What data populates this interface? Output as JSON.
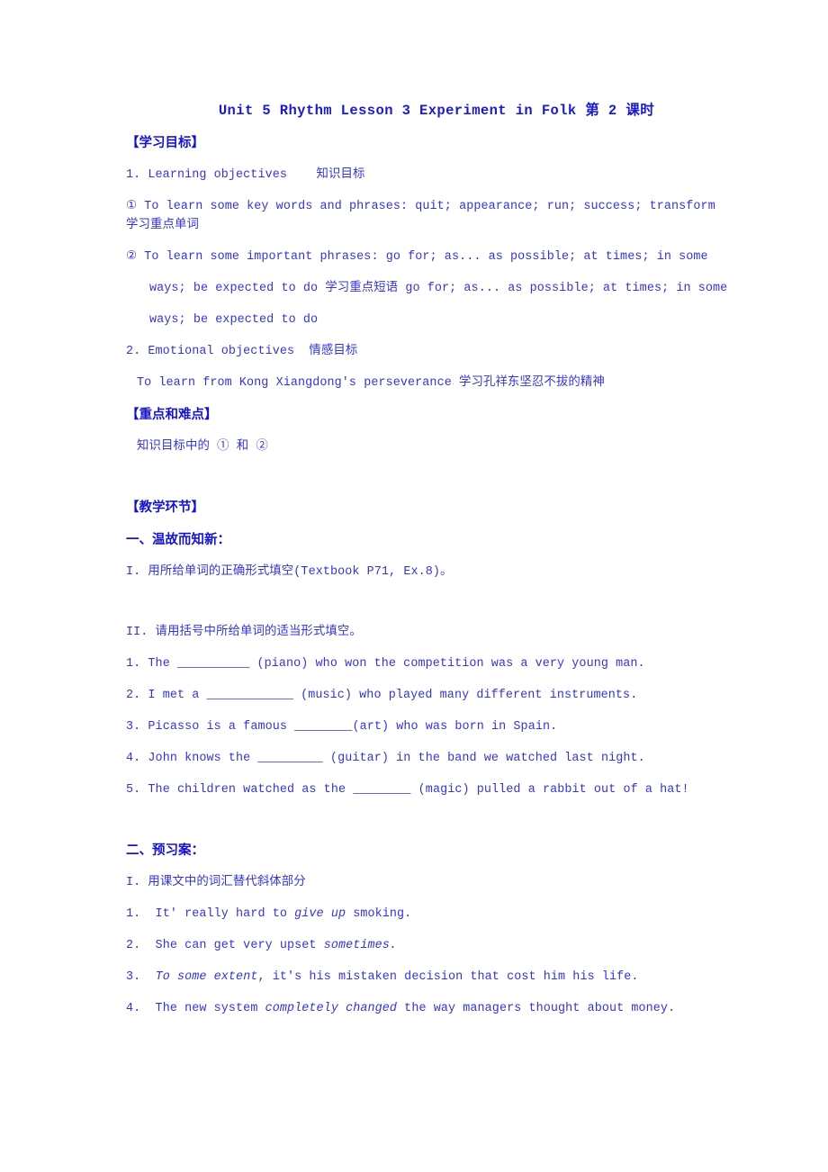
{
  "document": {
    "title": "Unit 5  Rhythm  Lesson 3 Experiment in Folk 第 2 课时",
    "sections": {
      "learning_goals_heading": "【学习目标】",
      "goal1": "1. Learning objectives    知识目标",
      "goal1_item1": "① To learn some key words and phrases: quit; appearance; run; success; transform",
      "goal1_item1_cn": "学习重点单词",
      "goal1_item2": "② To learn some important phrases: go for; as... as possible; at times; in some",
      "goal1_item2_cont": "ways; be expected to do 学习重点短语 go for; as... as possible; at times; in some",
      "goal1_item2_cont2": "ways; be expected to do",
      "goal2": "2. Emotional objectives  情感目标",
      "goal2_text": "To learn from Kong Xiangdong's perseverance 学习孔祥东坚忍不拔的精神",
      "key_points_heading": "【重点和难点】",
      "key_points_text": "知识目标中的 ① 和 ②",
      "teaching_steps_heading": "【教学环节】",
      "part_one_heading": "一、温故而知新：",
      "part_one_ex1": "I. 用所给单词的正确形式填空(Textbook P71, Ex.8)。",
      "part_one_ex2": "II. 请用括号中所给单词的适当形式填空。",
      "part_one_questions": [
        {
          "num": "1.",
          "pre": "The ",
          "blank": "__________",
          "post": " (piano) who won the competition was a very young man."
        },
        {
          "num": "2.",
          "pre": "I met a ",
          "blank": "____________",
          "post": " (music) who played many different instruments."
        },
        {
          "num": "3.",
          "pre": "Picasso is a famous ",
          "blank": "________",
          "post": "(art) who was born in Spain."
        },
        {
          "num": "4.",
          "pre": "John knows the ",
          "blank": "_________",
          "post": " (guitar) in the band we watched last night."
        },
        {
          "num": "5.",
          "pre": "The children watched as the ",
          "blank": "________",
          "post": " (magic) pulled a rabbit out of a hat!"
        }
      ],
      "part_two_heading": "二、预习案：",
      "part_two_ex1": "I. 用课文中的词汇替代斜体部分",
      "part_two_questions": [
        {
          "num": "1.",
          "pre": " It' really hard to ",
          "italic": "give up",
          "post": " smoking."
        },
        {
          "num": "2.",
          "pre": " She can get very upset ",
          "italic": "sometimes.",
          "post": ""
        },
        {
          "num": "3.",
          "pre": " ",
          "italic": "To some extent",
          "post": ", it's his mistaken decision that cost him his life."
        },
        {
          "num": "4.",
          "pre": " The new system ",
          "italic": "completely changed",
          "post": " the way managers thought about money."
        }
      ]
    }
  },
  "colors": {
    "text_blue": "#3434d6",
    "heading_blue": "#1414cc",
    "background": "#ffffff"
  }
}
